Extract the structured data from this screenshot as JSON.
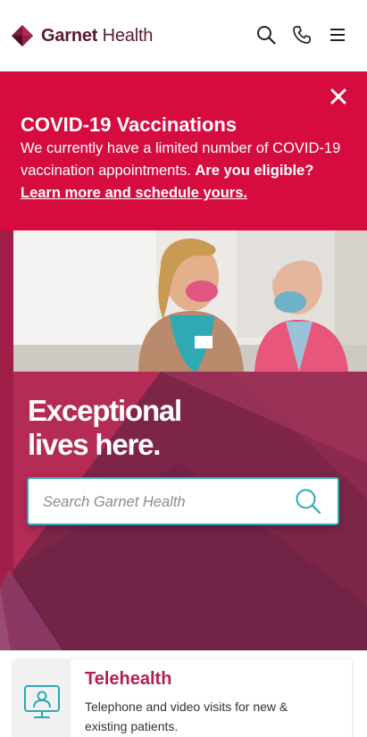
{
  "header": {
    "logo_bold": "Garnet",
    "logo_light": " Health",
    "icons": [
      "search-icon",
      "phone-icon",
      "menu-icon"
    ]
  },
  "banner": {
    "title": "COVID-19 Vaccinations",
    "text": "We currently have a limited number of COVID-19 vaccination appointments.",
    "text_bold": "Are you eligible?",
    "link": "Learn more and schedule yours.",
    "close_icon": "close-icon",
    "color": "#d60c3f"
  },
  "hero": {
    "heading_line1": "Exceptional",
    "heading_line2": "lives here.",
    "search": {
      "placeholder": "Search Garnet Health",
      "value": ""
    },
    "color": "#7c2548",
    "accent": "#2ba8b7"
  },
  "cards": [
    {
      "title": "Telehealth",
      "text": "Telephone and video visits for new & existing patients.",
      "icon": "telehealth-monitor-icon"
    }
  ],
  "colors": {
    "brand": "#5a1a32",
    "card_title": "#b3204f"
  }
}
